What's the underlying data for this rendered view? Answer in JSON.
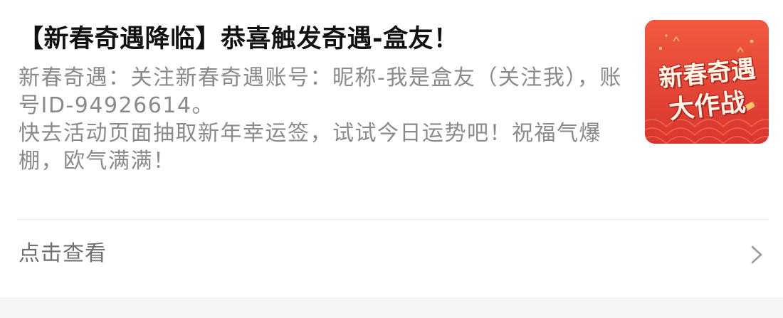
{
  "message": {
    "title": "【新春奇遇降临】恭喜触发奇遇-盒友！",
    "body_lines": [
      "新春奇遇：关注新春奇遇账号：昵称-我是盒友（关注我），账号ID-94926614。",
      "快去活动页面抽取新年幸运签，试试今日运势吧！祝福气爆棚，欧气满满！"
    ],
    "thumbnail": {
      "line1": "新春奇遇",
      "line2": "大作战",
      "bg_color": "#e8453c"
    }
  },
  "footer": {
    "label": "点击查看",
    "icon": "chevron-right-icon"
  }
}
